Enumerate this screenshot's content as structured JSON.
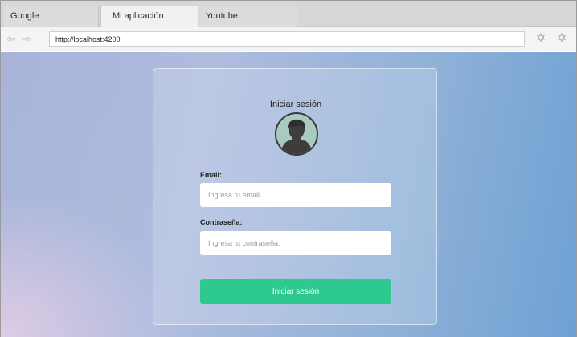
{
  "browser": {
    "tabs": [
      {
        "label": "Google"
      },
      {
        "label": "Mi aplicación"
      },
      {
        "label": "Youtube"
      }
    ],
    "url": "http://localhost:4200",
    "icons": {
      "back": "arrow-left-icon",
      "forward": "arrow-right-icon",
      "tool1": "settings-icon",
      "tool2": "settings-icon"
    }
  },
  "login": {
    "title": "Iniciar sesión",
    "email_label": "Email:",
    "email_placeholder": "Ingresa tu email.",
    "password_label": "Contraseña:",
    "password_placeholder": "Ingresa tu contraseña.",
    "submit_label": "Iniciar sesión"
  },
  "colors": {
    "button": "#2ec98f",
    "avatar_bg": "#a9cbbf",
    "page_gradient_end": "#6ea1d3"
  }
}
